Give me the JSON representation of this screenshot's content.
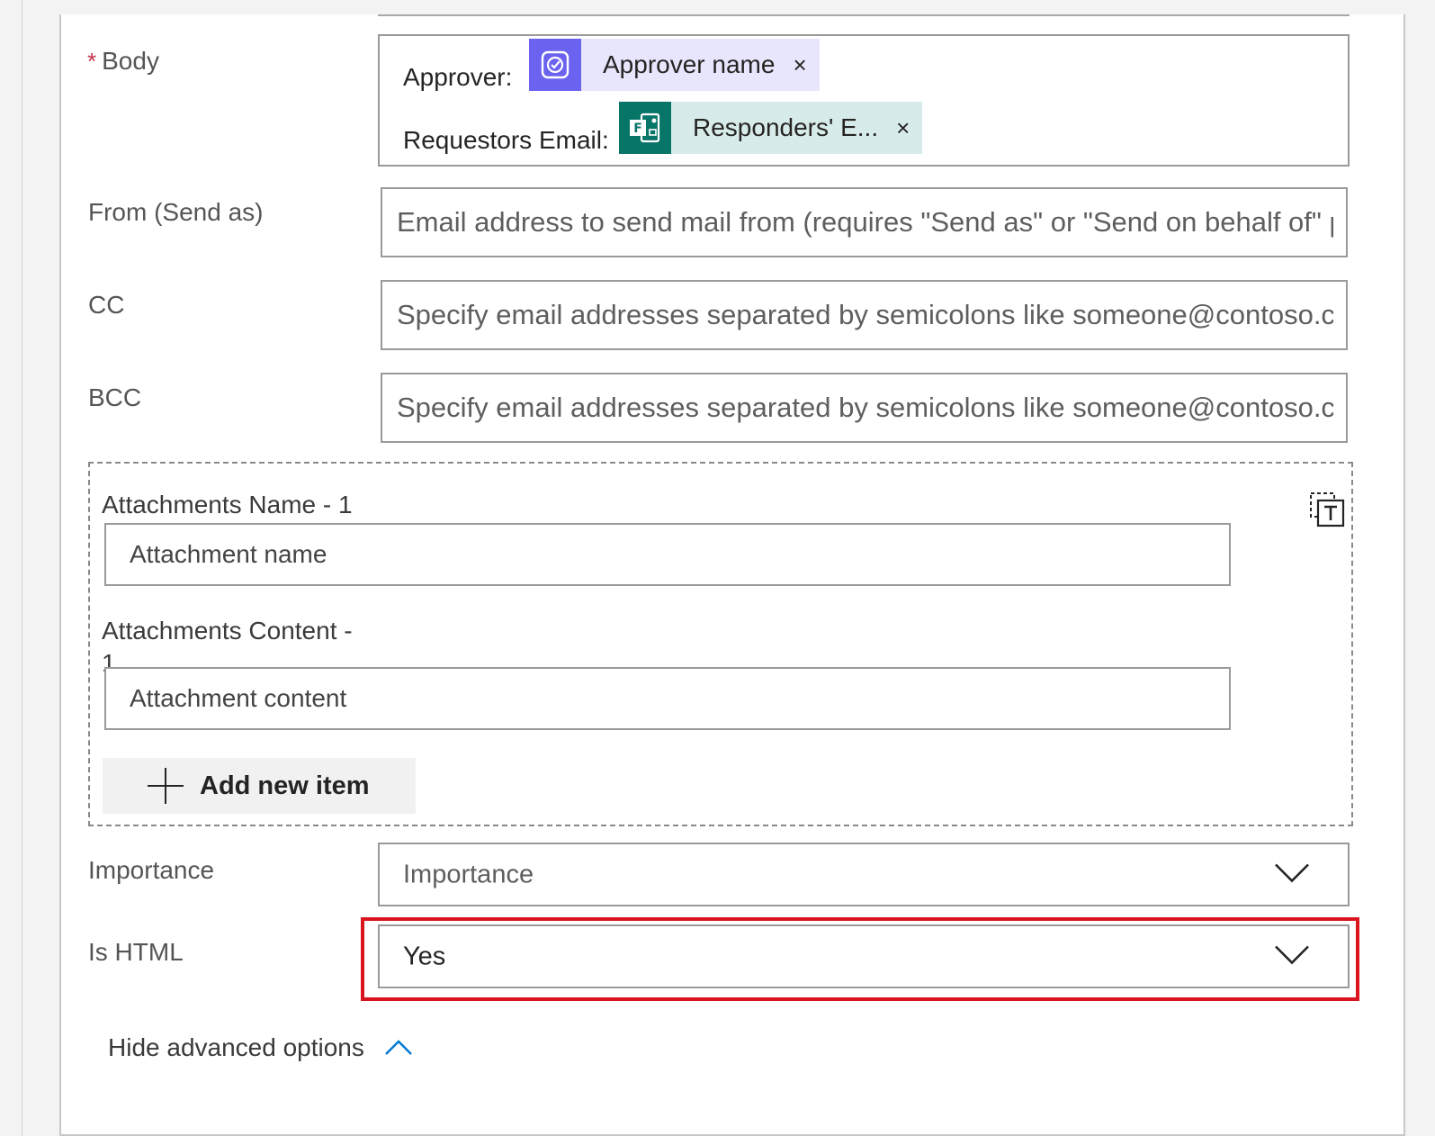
{
  "fields": {
    "body": {
      "required_marker": "*",
      "label": "Body",
      "line1_prefix": "Approver:",
      "line1_token": "Approver name",
      "line2_prefix": "Requestors Email:",
      "line2_token": "Responders' E...",
      "token_close": "×"
    },
    "from": {
      "label": "From (Send as)",
      "placeholder": "Email address to send mail from (requires \"Send as\" or \"Send on behalf of\" permission)"
    },
    "cc": {
      "label": "CC",
      "placeholder": "Specify email addresses separated by semicolons like someone@contoso.com"
    },
    "bcc": {
      "label": "BCC",
      "placeholder": "Specify email addresses separated by semicolons like someone@contoso.com"
    },
    "attachments": {
      "name_label": "Attachments Name - 1",
      "name_placeholder": "Attachment name",
      "content_label": "Attachments Content -",
      "content_label_suffix": "1",
      "content_placeholder": "Attachment content",
      "add_button": "Add new item"
    },
    "importance": {
      "label": "Importance",
      "placeholder": "Importance"
    },
    "is_html": {
      "label": "Is HTML",
      "value": "Yes"
    }
  },
  "hide_advanced": "Hide advanced options",
  "icons": {
    "approver_token": "approvals-icon",
    "responders_token": "forms-icon",
    "switch_mode": "text-mode-icon",
    "dropdown": "chevron-down-icon",
    "collapse": "chevron-up-icon"
  },
  "colors": {
    "approver_token_icon_bg": "#6b63f0",
    "approver_token_bg": "#e8e6fc",
    "forms_token_icon_bg": "#077568",
    "forms_token_bg": "#d7ecea",
    "highlight_border": "#d9141e",
    "link_accent": "#0078d4"
  }
}
